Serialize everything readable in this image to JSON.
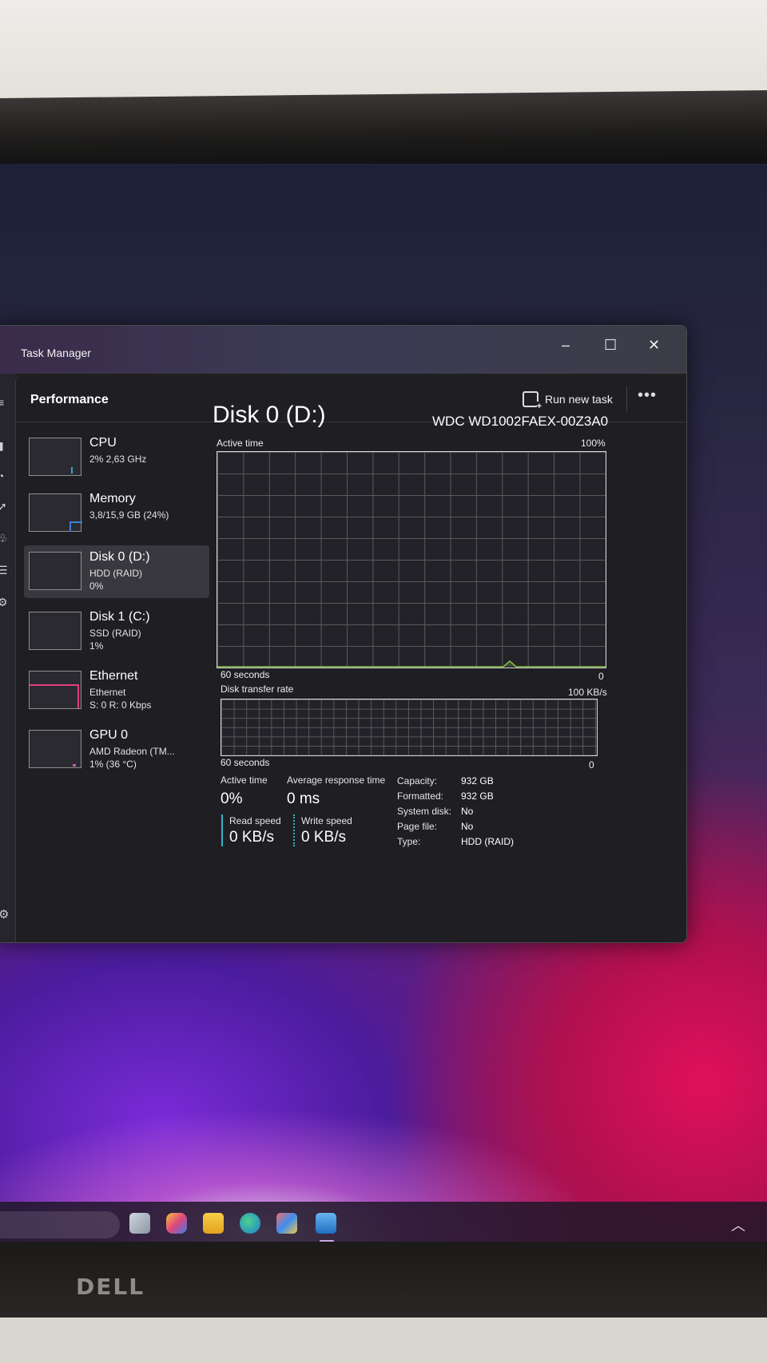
{
  "window": {
    "title": "Task Manager",
    "minimize": "–",
    "maximize": "☐",
    "close": "✕"
  },
  "header": {
    "page_title": "Performance",
    "run_new_task": "Run new task",
    "more": "•••"
  },
  "sidebar": {
    "items": [
      {
        "name": "CPU",
        "sub1": "2% 2,63 GHz",
        "sub2": "",
        "accent": "#3aa0d8"
      },
      {
        "name": "Memory",
        "sub1": "3,8/15,9 GB (24%)",
        "sub2": "",
        "accent": "#3b82d6"
      },
      {
        "name": "Disk 0 (D:)",
        "sub1": "HDD (RAID)",
        "sub2": "0%",
        "accent": "#8bc34a"
      },
      {
        "name": "Disk 1 (C:)",
        "sub1": "SSD (RAID)",
        "sub2": "1%",
        "accent": "#8bc34a"
      },
      {
        "name": "Ethernet",
        "sub1": "Ethernet",
        "sub2": "S: 0 R: 0 Kbps",
        "accent": "#e0407a"
      },
      {
        "name": "GPU 0",
        "sub1": "AMD Radeon (TM...",
        "sub2": "1% (36 °C)",
        "accent": "#c060c0"
      }
    ]
  },
  "detail": {
    "title": "Disk 0 (D:)",
    "model": "WDC WD1002FAEX-00Z3A0",
    "active_graph": {
      "label": "Active time",
      "max": "100%",
      "time_label": "60 seconds",
      "min": "0"
    },
    "transfer_graph": {
      "label": "Disk transfer rate",
      "max": "100 KB/s",
      "time_label": "60 seconds",
      "min": "0"
    },
    "stats": {
      "active_time_label": "Active time",
      "active_time_value": "0%",
      "avg_response_label": "Average response time",
      "avg_response_value": "0 ms",
      "read_label": "Read speed",
      "read_value": "0 KB/s",
      "write_label": "Write speed",
      "write_value": "0 KB/s"
    },
    "properties": [
      {
        "key": "Capacity:",
        "value": "932 GB"
      },
      {
        "key": "Formatted:",
        "value": "932 GB"
      },
      {
        "key": "System disk:",
        "value": "No"
      },
      {
        "key": "Page file:",
        "value": "No"
      },
      {
        "key": "Type:",
        "value": "HDD (RAID)"
      }
    ]
  },
  "colors": {
    "read": "#2fb6c9",
    "write": "#2fb6c9",
    "graph_line": "#8bc34a"
  },
  "monitor": {
    "brand": "DELL"
  }
}
